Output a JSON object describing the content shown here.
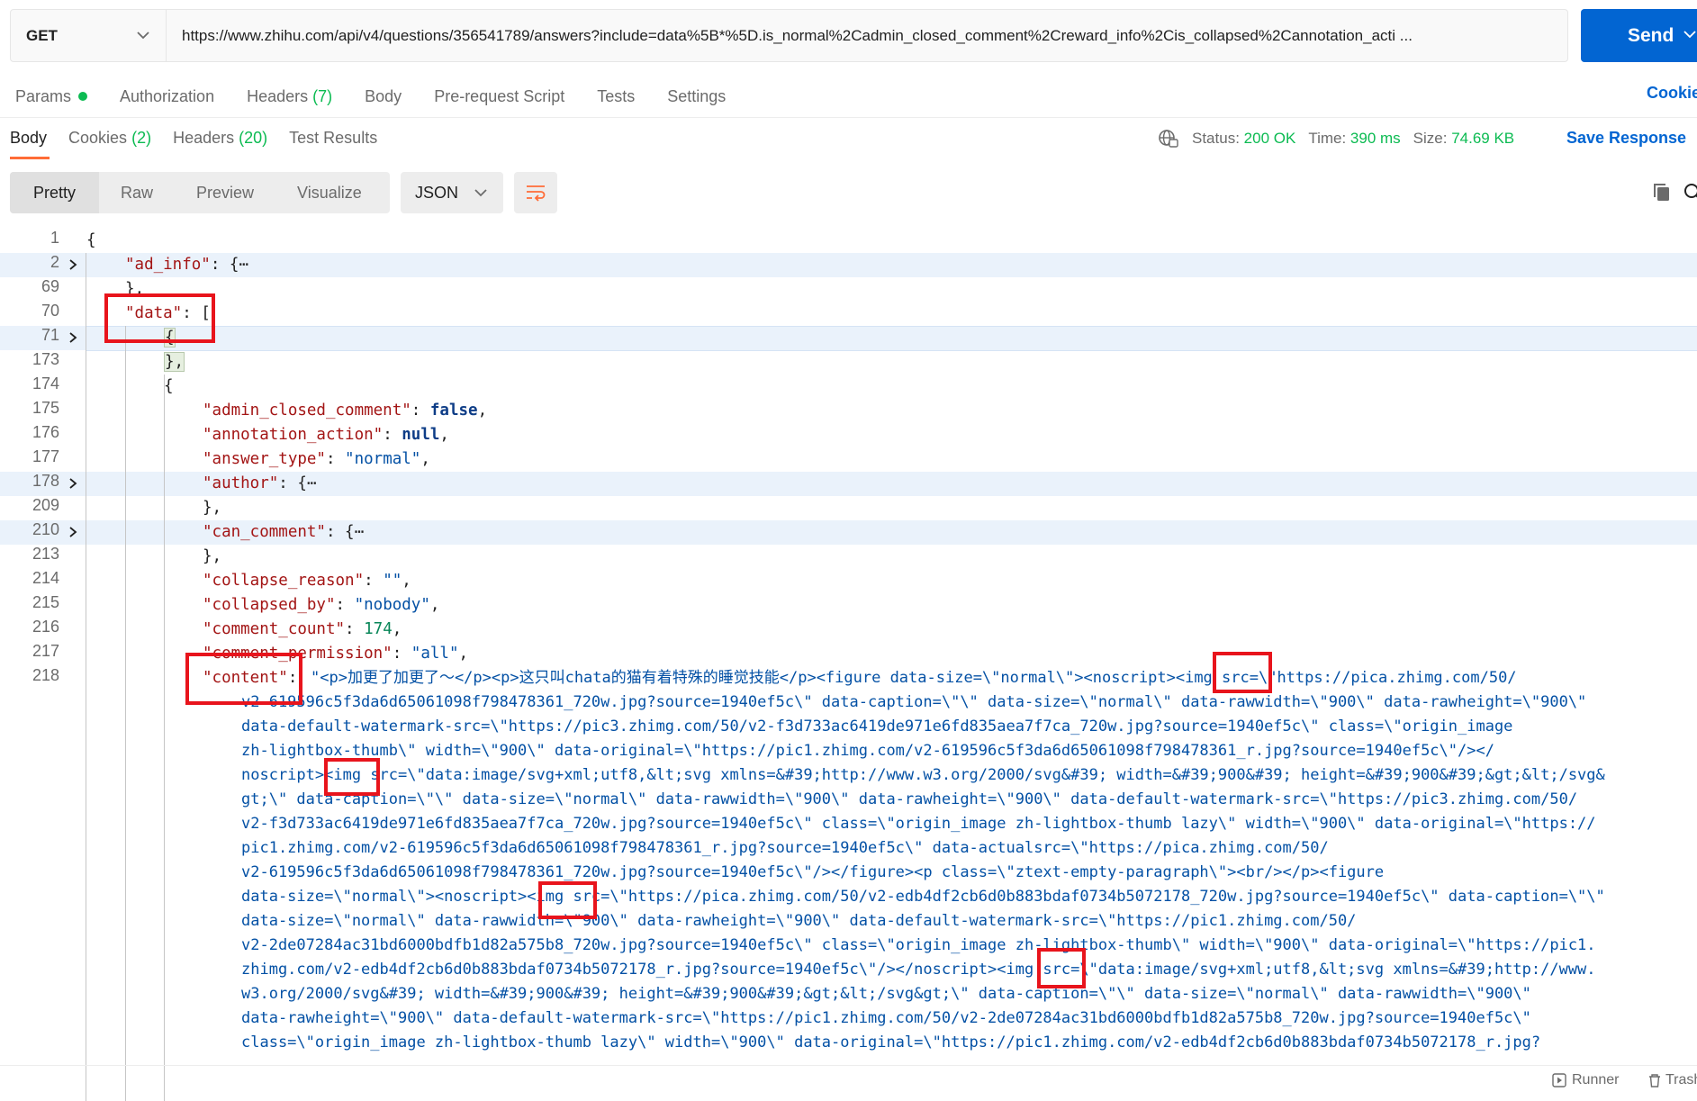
{
  "request": {
    "method": "GET",
    "url": "https://www.zhihu.com/api/v4/questions/356541789/answers?include=data%5B*%5D.is_normal%2Cadmin_closed_comment%2Creward_info%2Cis_collapsed%2Cannotation_acti ...",
    "send_label": "Send"
  },
  "request_tabs": [
    {
      "label": "Params",
      "extra": ""
    },
    {
      "label": "Authorization",
      "extra": ""
    },
    {
      "label": "Headers",
      "extra": "(7)"
    },
    {
      "label": "Body",
      "extra": ""
    },
    {
      "label": "Pre-request Script",
      "extra": ""
    },
    {
      "label": "Tests",
      "extra": ""
    },
    {
      "label": "Settings",
      "extra": ""
    }
  ],
  "cookies_link": "Cookie",
  "response_tabs": {
    "body": "Body",
    "cookies": "Cookies",
    "cookies_count": "(2)",
    "headers": "Headers",
    "headers_count": "(20)",
    "test_results": "Test Results"
  },
  "status": {
    "status_label": "Status:",
    "status_value": "200 OK",
    "time_label": "Time:",
    "time_value": "390 ms",
    "size_label": "Size:",
    "size_value": "74.69 KB",
    "save_response": "Save Response"
  },
  "view_tabs": [
    "Pretty",
    "Raw",
    "Preview",
    "Visualize"
  ],
  "format": "JSON",
  "line_numbers": [
    "1",
    "2",
    "69",
    "70",
    "71",
    "173",
    "174",
    "175",
    "176",
    "177",
    "178",
    "209",
    "210",
    "213",
    "214",
    "215",
    "216",
    "217",
    "218"
  ],
  "code": {
    "l1": "{",
    "l2_key": "\"ad_info\"",
    "l2_rest": ": {⋯",
    "l69": "},",
    "l70_key": "\"data\"",
    "l70_rest": ": [",
    "l71": "{",
    "l173": "},",
    "l174": "{",
    "l175_key": "\"admin_closed_comment\"",
    "l175_val": "false",
    "l176_key": "\"annotation_action\"",
    "l176_val": "null",
    "l177_key": "\"answer_type\"",
    "l177_val": "\"normal\"",
    "l178_key": "\"author\"",
    "l178_rest": ": {⋯",
    "l209": "},",
    "l210_key": "\"can_comment\"",
    "l210_rest": ": {⋯",
    "l213": "},",
    "l214_key": "\"collapse_reason\"",
    "l214_val": "\"\"",
    "l215_key": "\"collapsed_by\"",
    "l215_val": "\"nobody\"",
    "l216_key": "\"comment_count\"",
    "l216_val": "174",
    "l217_key": "\"comment_permission\"",
    "l217_val": "\"all\"",
    "l218_key": "\"content\"",
    "content_lines": [
      "\"<p>加更了加更了～</p><p>这只叫chata的猫有着特殊的睡觉技能</p><figure data-size=\\\"normal\\\"><noscript><img src=\\\"https://pica.zhimg.com/50/",
      "v2-619596c5f3da6d65061098f798478361_720w.jpg?source=1940ef5c\\\" data-caption=\\\"\\\" data-size=\\\"normal\\\" data-rawwidth=\\\"900\\\" data-rawheight=\\\"900\\\"",
      "data-default-watermark-src=\\\"https://pic3.zhimg.com/50/v2-f3d733ac6419de971e6fd835aea7f7ca_720w.jpg?source=1940ef5c\\\" class=\\\"origin_image",
      "zh-lightbox-thumb\\\" width=\\\"900\\\" data-original=\\\"https://pic1.zhimg.com/v2-619596c5f3da6d65061098f798478361_r.jpg?source=1940ef5c\\\"/></",
      "noscript><img src=\\\"data:image/svg+xml;utf8,&lt;svg xmlns=&#39;http://www.w3.org/2000/svg&#39; width=&#39;900&#39; height=&#39;900&#39;&gt;&lt;/svg&",
      "gt;\\\" data-caption=\\\"\\\" data-size=\\\"normal\\\" data-rawwidth=\\\"900\\\" data-rawheight=\\\"900\\\" data-default-watermark-src=\\\"https://pic3.zhimg.com/50/",
      "v2-f3d733ac6419de971e6fd835aea7f7ca_720w.jpg?source=1940ef5c\\\" class=\\\"origin_image zh-lightbox-thumb lazy\\\" width=\\\"900\\\" data-original=\\\"https://",
      "pic1.zhimg.com/v2-619596c5f3da6d65061098f798478361_r.jpg?source=1940ef5c\\\" data-actualsrc=\\\"https://pica.zhimg.com/50/",
      "v2-619596c5f3da6d65061098f798478361_720w.jpg?source=1940ef5c\\\"/></figure><p class=\\\"ztext-empty-paragraph\\\"><br/></p><figure",
      "data-size=\\\"normal\\\"><noscript><img src=\\\"https://pica.zhimg.com/50/v2-edb4df2cb6d0b883bdaf0734b5072178_720w.jpg?source=1940ef5c\\\" data-caption=\\\"\\\"",
      "data-size=\\\"normal\\\" data-rawwidth=\\\"900\\\" data-rawheight=\\\"900\\\" data-default-watermark-src=\\\"https://pic1.zhimg.com/50/",
      "v2-2de07284ac31bd6000bdfb1d82a575b8_720w.jpg?source=1940ef5c\\\" class=\\\"origin_image zh-lightbox-thumb\\\" width=\\\"900\\\" data-original=\\\"https://pic1.",
      "zhimg.com/v2-edb4df2cb6d0b883bdaf0734b5072178_r.jpg?source=1940ef5c\\\"/></noscript><img src=\\\"data:image/svg+xml;utf8,&lt;svg xmlns=&#39;http://www.",
      "w3.org/2000/svg&#39; width=&#39;900&#39; height=&#39;900&#39;&gt;&lt;/svg&gt;\\\" data-caption=\\\"\\\" data-size=\\\"normal\\\" data-rawwidth=\\\"900\\\"",
      "data-rawheight=\\\"900\\\" data-default-watermark-src=\\\"https://pic1.zhimg.com/50/v2-2de07284ac31bd6000bdfb1d82a575b8_720w.jpg?source=1940ef5c\\\"",
      "class=\\\"origin_image zh-lightbox-thumb lazy\\\" width=\\\"900\\\" data-original=\\\"https://pic1.zhimg.com/v2-edb4df2cb6d0b883bdaf0734b5072178_r.jpg?"
    ]
  },
  "footer": {
    "runner": "Runner",
    "trash": "Trash"
  },
  "colors": {
    "accent": "#0265d2",
    "tab_underline": "#ff6c37",
    "status_ok": "#0cbb52",
    "annotation": "#e8141c"
  }
}
